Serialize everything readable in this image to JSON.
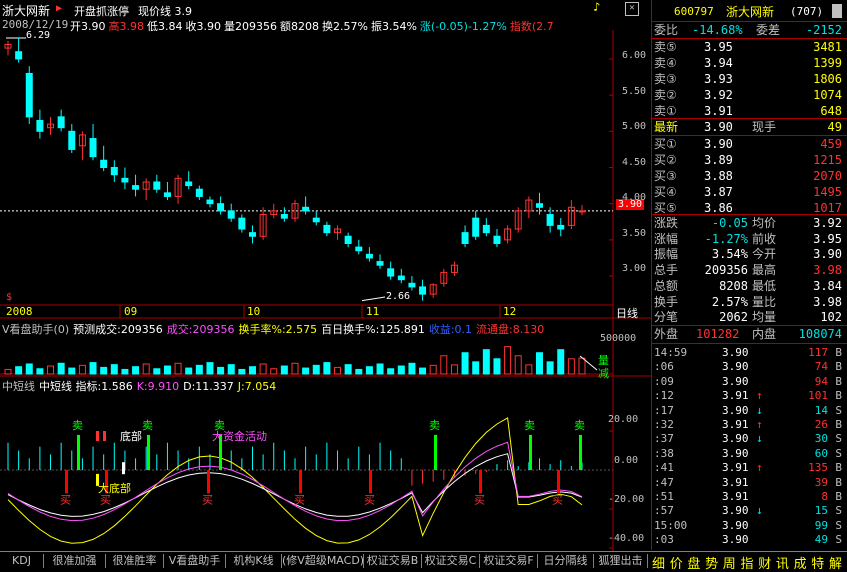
{
  "stock": {
    "name": "浙大网新",
    "code": "600797",
    "panel_title": "浙大网新",
    "count": "(707)"
  },
  "main_header": {
    "date": "2008/12/19",
    "fields": [
      {
        "t": "开3.90",
        "c": "#ffffff"
      },
      {
        "t": "高3.98",
        "c": "#ff3232"
      },
      {
        "t": "低3.84",
        "c": "#ffffff"
      },
      {
        "t": "收3.90",
        "c": "#ffffff"
      },
      {
        "t": "量209356",
        "c": "#ffffff"
      },
      {
        "t": "额8208",
        "c": "#ffffff"
      },
      {
        "t": "换2.57%",
        "c": "#ffffff"
      },
      {
        "t": "振3.54%",
        "c": "#ffffff"
      },
      {
        "t": "涨(-0.05)-1.27%",
        "c": "#00e0e0"
      },
      {
        "t": "指数(2.7",
        "c": "#ff3232"
      }
    ],
    "indicator_name": "开盘抓涨停",
    "price_line_label": "现价线 3.9",
    "high_mark": "6.29",
    "low_mark": "2.66",
    "current_price_tag": "3.90",
    "price_axis": [
      "6.00",
      "5.50",
      "5.00",
      "4.50",
      "4.00",
      "3.50",
      "3.00"
    ],
    "months": [
      "2008",
      "09",
      "10",
      "11",
      "12"
    ],
    "period": "日线"
  },
  "volume_header": {
    "items": [
      {
        "t": "V看盘助手(0)",
        "c": "#c0c0c0"
      },
      {
        "t": "预测成交:209356",
        "c": "#ffffff"
      },
      {
        "t": "成交:209356",
        "c": "#ff50ff"
      },
      {
        "t": "换手率%:2.575",
        "c": "#ffff00"
      },
      {
        "t": "百日换手%:125.891",
        "c": "#ffffff"
      },
      {
        "t": "收益:0.1",
        "c": "#3060ff"
      },
      {
        "t": "流通盘:8.130",
        "c": "#ff3232"
      }
    ],
    "axis_top": "500000",
    "label_up": "量",
    "label_down": "减"
  },
  "indicator_header": {
    "items": [
      {
        "t": "中短线",
        "c": "#c0c0c0"
      },
      {
        "t": "中短线 指标:1.586",
        "c": "#ffffff"
      },
      {
        "t": "K:9.910",
        "c": "#ff50ff"
      },
      {
        "t": "D:11.337",
        "c": "#ffffff"
      },
      {
        "t": "J:7.054",
        "c": "#ffff00"
      }
    ],
    "axis": [
      "20.00",
      "0.00",
      "-20.00",
      "-40.00"
    ],
    "annotations": {
      "sell": "卖",
      "buy": "买",
      "bottom": "底部",
      "big_bottom": "大底部",
      "funds": "大资金活动"
    }
  },
  "panel": {
    "weibi": {
      "label": "委比",
      "value": "-14.68%",
      "label2": "委差",
      "value2": "-2152"
    },
    "sells": [
      {
        "label": "卖⑤",
        "price": "3.95",
        "vol": "3481"
      },
      {
        "label": "卖④",
        "price": "3.94",
        "vol": "1399"
      },
      {
        "label": "卖③",
        "price": "3.93",
        "vol": "1806"
      },
      {
        "label": "卖②",
        "price": "3.92",
        "vol": "1074"
      },
      {
        "label": "卖①",
        "price": "3.91",
        "vol": "648"
      }
    ],
    "last": {
      "label": "最新",
      "price": "3.90",
      "label2": "现手",
      "vol": "49"
    },
    "buys": [
      {
        "label": "买①",
        "price": "3.90",
        "vol": "459"
      },
      {
        "label": "买②",
        "price": "3.89",
        "vol": "1215"
      },
      {
        "label": "买③",
        "price": "3.88",
        "vol": "2070"
      },
      {
        "label": "买④",
        "price": "3.87",
        "vol": "1495"
      },
      {
        "label": "买⑤",
        "price": "3.86",
        "vol": "1017"
      }
    ],
    "stats": [
      {
        "l1": "涨跌",
        "v1": "-0.05",
        "c1": "#00e0e0",
        "l2": "均价",
        "v2": "3.92",
        "c2": "#ffffff"
      },
      {
        "l1": "涨幅",
        "v1": "-1.27%",
        "c1": "#00e0e0",
        "l2": "前收",
        "v2": "3.95",
        "c2": "#ffffff"
      },
      {
        "l1": "振幅",
        "v1": "3.54%",
        "c1": "#ffffff",
        "l2": "今开",
        "v2": "3.90",
        "c2": "#ffffff"
      },
      {
        "l1": "总手",
        "v1": "209356",
        "c1": "#ffffff",
        "l2": "最高",
        "v2": "3.98",
        "c2": "#ff3232"
      },
      {
        "l1": "总额",
        "v1": "8208",
        "c1": "#ffffff",
        "l2": "最低",
        "v2": "3.84",
        "c2": "#ffffff"
      },
      {
        "l1": "换手",
        "v1": "2.57%",
        "c1": "#ffffff",
        "l2": "量比",
        "v2": "3.98",
        "c2": "#ffffff"
      },
      {
        "l1": "分笔",
        "v1": "2062",
        "c1": "#ffffff",
        "l2": "均量",
        "v2": "102",
        "c2": "#ffffff"
      }
    ],
    "outer": {
      "label": "外盘",
      "value": "101282",
      "label2": "内盘",
      "value2": "108074"
    },
    "ticks": [
      {
        "time": "14:59",
        "price": "3.90",
        "vol": "117",
        "dir": "B"
      },
      {
        "time": ":06",
        "price": "3.90",
        "vol": "74",
        "dir": "B"
      },
      {
        "time": ":09",
        "price": "3.90",
        "vol": "94",
        "dir": "B"
      },
      {
        "time": ":12",
        "price": "3.91",
        "arrow": "↑",
        "vol": "101",
        "dir": "B"
      },
      {
        "time": ":17",
        "price": "3.90",
        "arrow": "↓",
        "vol": "14",
        "dir": "S"
      },
      {
        "time": ":32",
        "price": "3.91",
        "arrow": "↑",
        "vol": "26",
        "dir": "B"
      },
      {
        "time": ":37",
        "price": "3.90",
        "arrow": "↓",
        "vol": "30",
        "dir": "S"
      },
      {
        "time": ":38",
        "price": "3.90",
        "vol": "60",
        "dir": "S"
      },
      {
        "time": ":41",
        "price": "3.91",
        "arrow": "↑",
        "vol": "135",
        "dir": "B"
      },
      {
        "time": ":47",
        "price": "3.91",
        "vol": "39",
        "dir": "B"
      },
      {
        "time": ":51",
        "price": "3.91",
        "vol": "8",
        "dir": "B"
      },
      {
        "time": ":57",
        "price": "3.90",
        "arrow": "↓",
        "vol": "15",
        "dir": "S"
      },
      {
        "time": "15:00",
        "price": "3.90",
        "vol": "99",
        "dir": "S"
      },
      {
        "time": ":03",
        "price": "3.90",
        "vol": "49",
        "dir": "S"
      }
    ]
  },
  "bottom_tabs": [
    "KDJ",
    "很准加强",
    "很准胜率",
    "V看盘助手",
    "机构K线",
    "(修V超级MACD)",
    "权证交易B",
    "权证交易C",
    "权证交易F",
    "日分隔线",
    "狐狸出击"
  ],
  "right_tabs": [
    "细",
    "价",
    "盘",
    "势",
    "周",
    "指",
    "财",
    "讯",
    "成",
    "特",
    "解"
  ],
  "chart_data": [
    {
      "type": "candlestick",
      "title": "浙大网新",
      "x": [
        "2008-08",
        "2008-09",
        "2008-10",
        "2008-11",
        "2008-12"
      ],
      "ohlc_approx": [
        [
          6.15,
          6.25,
          6.05,
          6.2
        ],
        [
          6.1,
          6.29,
          5.95,
          6.0
        ],
        [
          5.8,
          5.9,
          5.1,
          5.2
        ],
        [
          5.15,
          5.3,
          4.9,
          5.0
        ],
        [
          5.05,
          5.2,
          4.95,
          5.1
        ],
        [
          5.2,
          5.3,
          5.0,
          5.05
        ],
        [
          5.0,
          5.1,
          4.7,
          4.75
        ],
        [
          4.8,
          5.0,
          4.6,
          4.95
        ],
        [
          4.9,
          5.1,
          4.6,
          4.65
        ],
        [
          4.6,
          4.8,
          4.45,
          4.5
        ],
        [
          4.5,
          4.6,
          4.3,
          4.4
        ],
        [
          4.35,
          4.5,
          4.2,
          4.3
        ],
        [
          4.25,
          4.4,
          4.1,
          4.2
        ],
        [
          4.2,
          4.35,
          4.05,
          4.3
        ],
        [
          4.3,
          4.4,
          4.15,
          4.2
        ],
        [
          4.15,
          4.3,
          4.05,
          4.1
        ],
        [
          4.1,
          4.4,
          4.0,
          4.35
        ],
        [
          4.3,
          4.45,
          4.2,
          4.25
        ],
        [
          4.2,
          4.25,
          4.05,
          4.1
        ],
        [
          4.05,
          4.1,
          3.95,
          4.0
        ],
        [
          4.0,
          4.1,
          3.85,
          3.9
        ],
        [
          3.9,
          4.0,
          3.75,
          3.8
        ],
        [
          3.8,
          3.85,
          3.6,
          3.65
        ],
        [
          3.6,
          3.7,
          3.45,
          3.55
        ],
        [
          3.55,
          3.95,
          3.5,
          3.85
        ],
        [
          3.85,
          4.0,
          3.8,
          3.9
        ],
        [
          3.85,
          3.95,
          3.75,
          3.8
        ],
        [
          3.8,
          4.05,
          3.75,
          4.0
        ],
        [
          3.95,
          4.1,
          3.85,
          3.9
        ],
        [
          3.8,
          3.9,
          3.7,
          3.75
        ],
        [
          3.7,
          3.75,
          3.55,
          3.6
        ],
        [
          3.6,
          3.7,
          3.5,
          3.65
        ],
        [
          3.55,
          3.6,
          3.4,
          3.45
        ],
        [
          3.4,
          3.5,
          3.3,
          3.35
        ],
        [
          3.3,
          3.4,
          3.2,
          3.25
        ],
        [
          3.2,
          3.3,
          3.1,
          3.15
        ],
        [
          3.1,
          3.2,
          2.95,
          3.0
        ],
        [
          3.0,
          3.1,
          2.9,
          2.95
        ],
        [
          2.9,
          3.0,
          2.8,
          2.85
        ],
        [
          2.85,
          2.95,
          2.66,
          2.75
        ],
        [
          2.75,
          2.9,
          2.7,
          2.88
        ],
        [
          2.9,
          3.1,
          2.85,
          3.05
        ],
        [
          3.05,
          3.2,
          3.0,
          3.15
        ],
        [
          3.6,
          3.7,
          3.4,
          3.45
        ],
        [
          3.8,
          3.9,
          3.5,
          3.55
        ],
        [
          3.7,
          3.8,
          3.55,
          3.6
        ],
        [
          3.55,
          3.65,
          3.4,
          3.45
        ],
        [
          3.5,
          3.7,
          3.45,
          3.65
        ],
        [
          3.65,
          3.95,
          3.6,
          3.9
        ],
        [
          3.9,
          4.1,
          3.8,
          4.05
        ],
        [
          4.0,
          4.15,
          3.85,
          3.95
        ],
        [
          3.85,
          3.95,
          3.6,
          3.7
        ],
        [
          3.7,
          3.8,
          3.55,
          3.65
        ],
        [
          3.7,
          4.05,
          3.65,
          3.95
        ],
        [
          3.9,
          3.98,
          3.84,
          3.9
        ]
      ],
      "ylim": [
        2.6,
        6.4
      ]
    },
    {
      "type": "bar",
      "title": "V看盘助手",
      "ylim": [
        0,
        500000
      ],
      "last_value": 209356
    },
    {
      "type": "line",
      "title": "中短线",
      "series": [
        {
          "name": "K",
          "last": 9.91
        },
        {
          "name": "D",
          "last": 11.337
        },
        {
          "name": "J",
          "last": 7.054
        }
      ],
      "ylim": [
        -40,
        40
      ]
    }
  ]
}
